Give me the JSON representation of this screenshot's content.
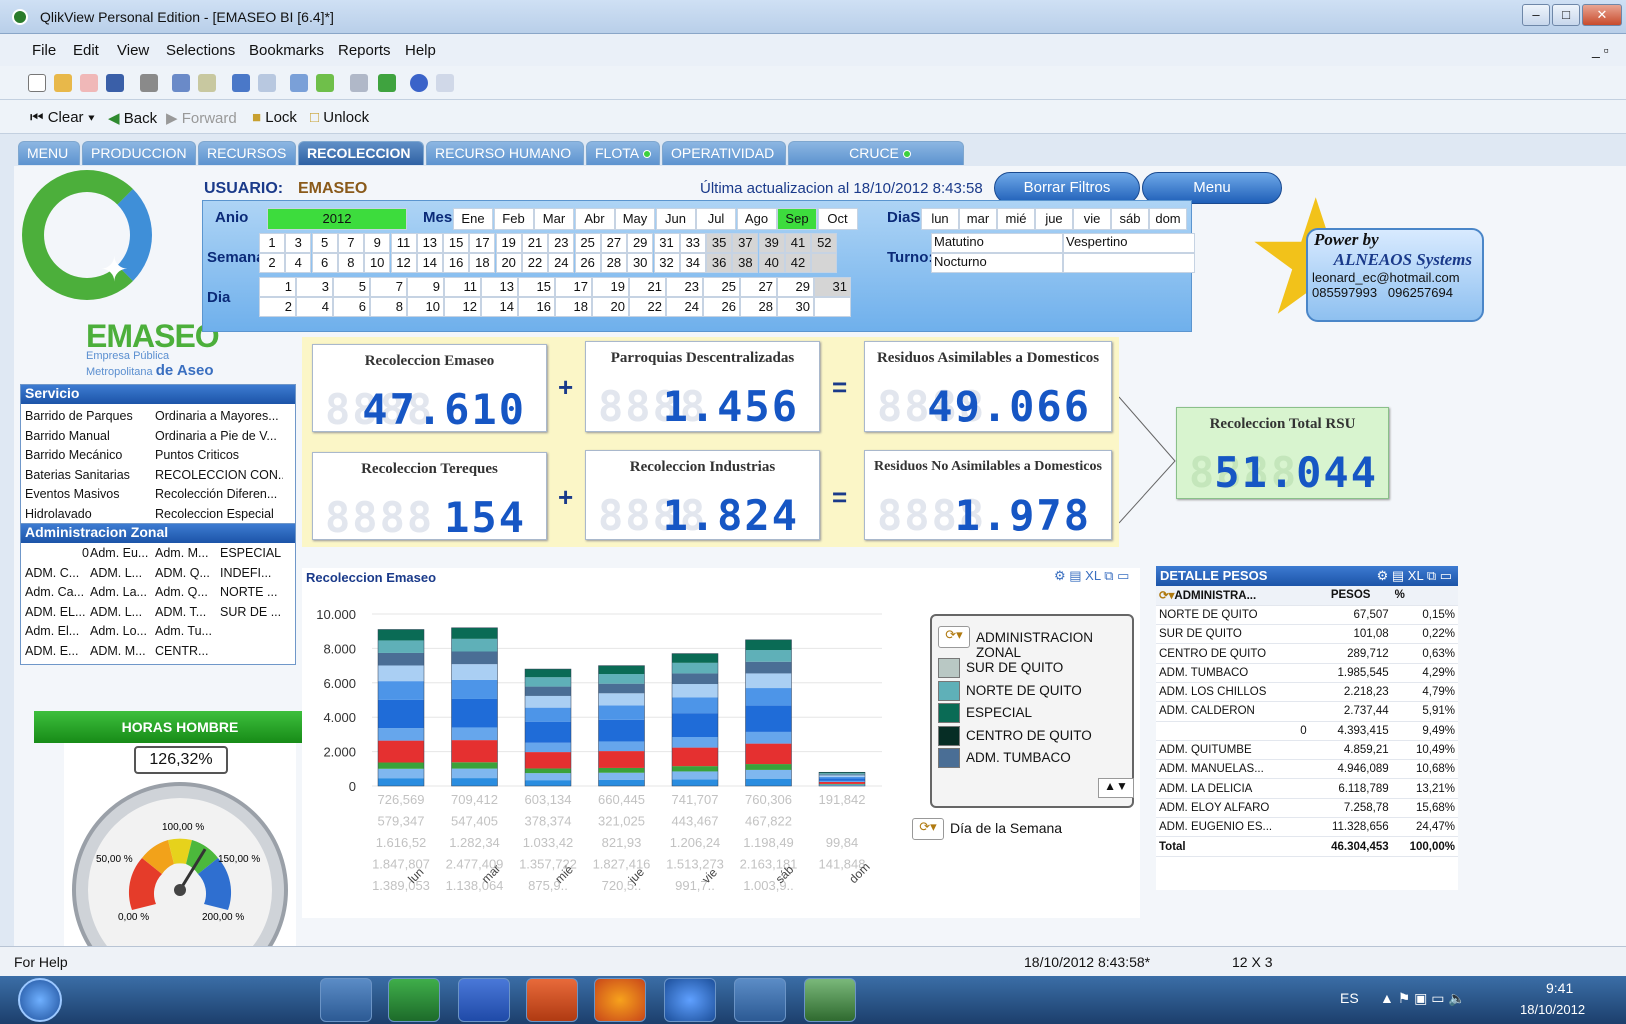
{
  "window": {
    "title": "QlikView Personal Edition - [EMASEO BI [6.4]*]"
  },
  "menu": [
    "File",
    "Edit",
    "View",
    "Selections",
    "Bookmarks",
    "Reports",
    "Help"
  ],
  "nav": {
    "clear": "Clear",
    "back": "Back",
    "forward": "Forward",
    "lock": "Lock",
    "unlock": "Unlock"
  },
  "tabs": [
    "MENU",
    "PRODUCCION",
    "RECURSOS",
    "RECOLECCION",
    "RECURSO HUMANO",
    "FLOTA",
    "OPERATIVIDAD",
    "CRUCE"
  ],
  "header": {
    "usuario_label": "USUARIO:",
    "usuario": "EMASEO",
    "update": "Última actualizacion al  18/10/2012 8:43:58",
    "borrar": "Borrar Filtros",
    "menu": "Menu"
  },
  "logo": {
    "name": "EMASEO",
    "sub1": "Empresa Pública",
    "sub2": "Metropolitana",
    "sub3": "de Aseo"
  },
  "filters": {
    "anio_label": "Anio",
    "anio": "2012",
    "mes_label": "Mes:",
    "meses": [
      "Ene",
      "Feb",
      "Mar",
      "Abr",
      "May",
      "Jun",
      "Jul",
      "Ago",
      "Sep",
      "Oct"
    ],
    "diasem_label": "DiaSem:",
    "dias": [
      "lun",
      "mar",
      "mié",
      "jue",
      "vie",
      "sáb",
      "dom"
    ],
    "semana_label": "Semana",
    "semana_top": [
      "1",
      "3",
      "5",
      "7",
      "9",
      "11",
      "13",
      "15",
      "17",
      "19",
      "21",
      "23",
      "25",
      "27",
      "29",
      "31",
      "33",
      "35",
      "37",
      "39",
      "41",
      "52"
    ],
    "semana_bot": [
      "2",
      "4",
      "6",
      "8",
      "10",
      "12",
      "14",
      "16",
      "18",
      "20",
      "22",
      "24",
      "26",
      "28",
      "30",
      "32",
      "34",
      "36",
      "38",
      "40",
      "42",
      ""
    ],
    "turno_label": "Turno:",
    "turnos": [
      "Matutino",
      "Vespertino",
      "Nocturno"
    ],
    "dia_label": "Dia",
    "dia_top": [
      "1",
      "3",
      "5",
      "7",
      "9",
      "11",
      "13",
      "15",
      "17",
      "19",
      "21",
      "23",
      "25",
      "27",
      "29",
      "31"
    ],
    "dia_bot": [
      "2",
      "4",
      "6",
      "8",
      "10",
      "12",
      "14",
      "16",
      "18",
      "20",
      "22",
      "24",
      "26",
      "28",
      "30",
      ""
    ]
  },
  "servicio": {
    "title": "Servicio",
    "items": [
      "Barrido de Parques",
      "Ordinaria a Mayores...",
      "Barrido Manual",
      "Ordinaria a Pie de V...",
      "Barrido Mecánico",
      "Puntos Criticos",
      "Baterias Sanitarias",
      "RECOLECCION CON...",
      "Eventos Masivos",
      "Recolección Diferen...",
      "Hidrolavado",
      "Recoleccion Especial"
    ]
  },
  "admzonal": {
    "title": "Administracion Zonal",
    "items": [
      "0",
      "Adm. Eu...",
      "Adm. M...",
      "ESPECIAL",
      "ADM. C...",
      "ADM. L...",
      "ADM. Q...",
      "INDEFI...",
      "Adm. Ca...",
      "Adm. La...",
      "Adm. Q...",
      "NORTE ...",
      "ADM. EL...",
      "ADM. L...",
      "ADM. T...",
      "SUR DE ...",
      "Adm. El...",
      "Adm. Lo...",
      "Adm. Tu...",
      "",
      "ADM. E...",
      "ADM. M...",
      "CENTR...",
      ""
    ]
  },
  "power": {
    "l1": "Power by",
    "l2": "ALNEAOS Systems",
    "l3": "leonard_ec@hotmail.com",
    "l4": "085597993   096257694"
  },
  "kpis": {
    "emaseo": {
      "title": "Recoleccion Emaseo",
      "value": "47.610"
    },
    "parroquias": {
      "title": "Parroquias Descentralizadas",
      "value": "1.456"
    },
    "asimilables": {
      "title": "Residuos Asimilables a Domesticos",
      "value": "49.066"
    },
    "tereques": {
      "title": "Recoleccion Tereques",
      "value": "154"
    },
    "industrias": {
      "title": "Recoleccion Industrias",
      "value": "1.824"
    },
    "noasimilables": {
      "title": "Residuos No Asimilables a Domesticos",
      "value": "1.978"
    },
    "total": {
      "title": "Recoleccion Total RSU",
      "value": "51.044"
    },
    "ghost": "8888"
  },
  "horas": {
    "title": "HORAS HOMBRE",
    "value": "126,32%",
    "ticks": [
      "100,00 %",
      "50,00 %",
      "150,00 %",
      "0,00 %",
      "200,00 %"
    ],
    "gauge_value": 126.32
  },
  "chart_data": {
    "type": "bar",
    "title": "Recoleccion Emaseo",
    "categories": [
      "lun",
      "mar",
      "mié",
      "jue",
      "vie",
      "sáb",
      "dom"
    ],
    "ylim": [
      0,
      10000
    ],
    "yticks": [
      "10.000",
      "8.000",
      "6.000",
      "4.000",
      "2.000",
      "0"
    ],
    "totals": [
      9100,
      9200,
      6800,
      7000,
      7700,
      8500,
      800
    ],
    "legend_title": "ADMINISTRACION ZONAL",
    "legend": [
      "SUR DE QUITO",
      "NORTE DE QUITO",
      "ESPECIAL",
      "CENTRO DE QUITO",
      "ADM. TUMBACO"
    ],
    "legend_colors": [
      "#b9c8c4",
      "#5fb0b8",
      "#0a6b55",
      "#062d25",
      "#4a6e95"
    ],
    "dimension": "Día de la Semana",
    "rows": [
      [
        "726,569",
        "709,412",
        "603,134",
        "660,445",
        "741,707",
        "760,306",
        "191,842"
      ],
      [
        "579,347",
        "547,405",
        "378,374",
        "321,025",
        "443,467",
        "467,822",
        ""
      ],
      [
        "1.616,52",
        "1.282,34",
        "1.033,42",
        "821,93",
        "1.206,24",
        "1.198,49",
        "99,84"
      ],
      [
        "1.847,807",
        "2.477,409",
        "1.357,722",
        "1.827,416",
        "1.513,273",
        "2.163,181",
        "141,848"
      ],
      [
        "1.389,053",
        "1.138,064",
        "875,9..",
        "720,5..",
        "991,7..",
        "1.003,9..",
        ""
      ]
    ]
  },
  "detalle": {
    "title": "DETALLE PESOS",
    "cols": [
      "ADMINISTRA...",
      "PESOS",
      "%"
    ],
    "rows": [
      [
        "NORTE DE QUITO",
        "67,507",
        "0,15%"
      ],
      [
        "SUR DE QUITO",
        "101,08",
        "0,22%"
      ],
      [
        "CENTRO DE QUITO",
        "289,712",
        "0,63%"
      ],
      [
        "ADM. TUMBACO",
        "1.985,545",
        "4,29%"
      ],
      [
        "ADM. LOS CHILLOS",
        "2.218,23",
        "4,79%"
      ],
      [
        "ADM. CALDERON",
        "2.737,44",
        "5,91%"
      ],
      [
        "0",
        "4.393,415",
        "9,49%"
      ],
      [
        "ADM. QUITUMBE",
        "4.859,21",
        "10,49%"
      ],
      [
        "ADM. MANUELAS...",
        "4.946,089",
        "10,68%"
      ],
      [
        "ADM. LA DELICIA",
        "6.118,789",
        "13,21%"
      ],
      [
        "ADM. ELOY ALFARO",
        "7.258,78",
        "15,68%"
      ],
      [
        "ADM. EUGENIO ES...",
        "11.328,656",
        "24,47%"
      ],
      [
        "Total",
        "46.304,453",
        "100,00%"
      ]
    ]
  },
  "status": {
    "help": "For Help",
    "datetime": "18/10/2012 8:43:58*",
    "dims": "12 X 3"
  },
  "taskbar": {
    "lang": "ES",
    "time": "9:41",
    "date": "18/10/2012"
  }
}
